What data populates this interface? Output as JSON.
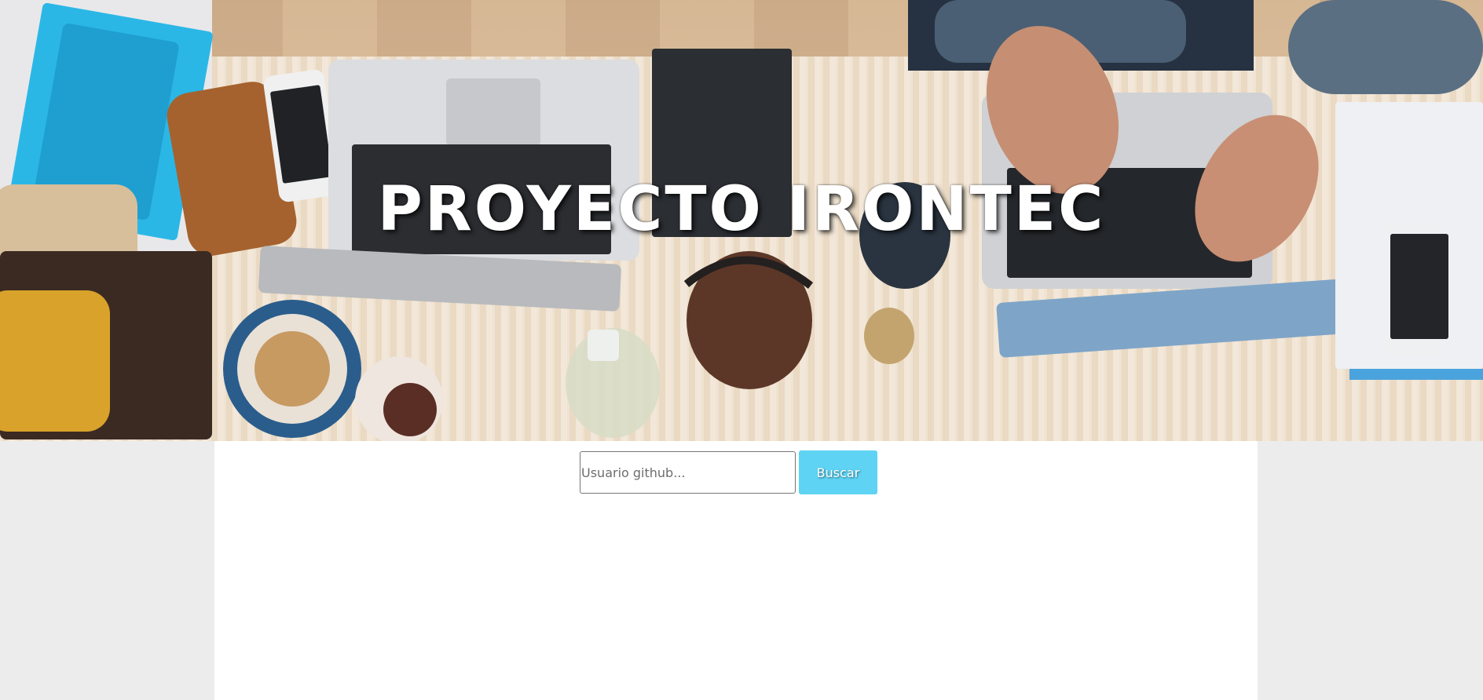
{
  "hero": {
    "title": "PROYECTO IRONTEC"
  },
  "search": {
    "placeholder": "Usuario github...",
    "value": "",
    "button_label": "Buscar"
  },
  "colors": {
    "page_background": "#ececec",
    "content_background": "#ffffff",
    "button_background": "#5ed3f3",
    "title_text": "#ffffff"
  }
}
